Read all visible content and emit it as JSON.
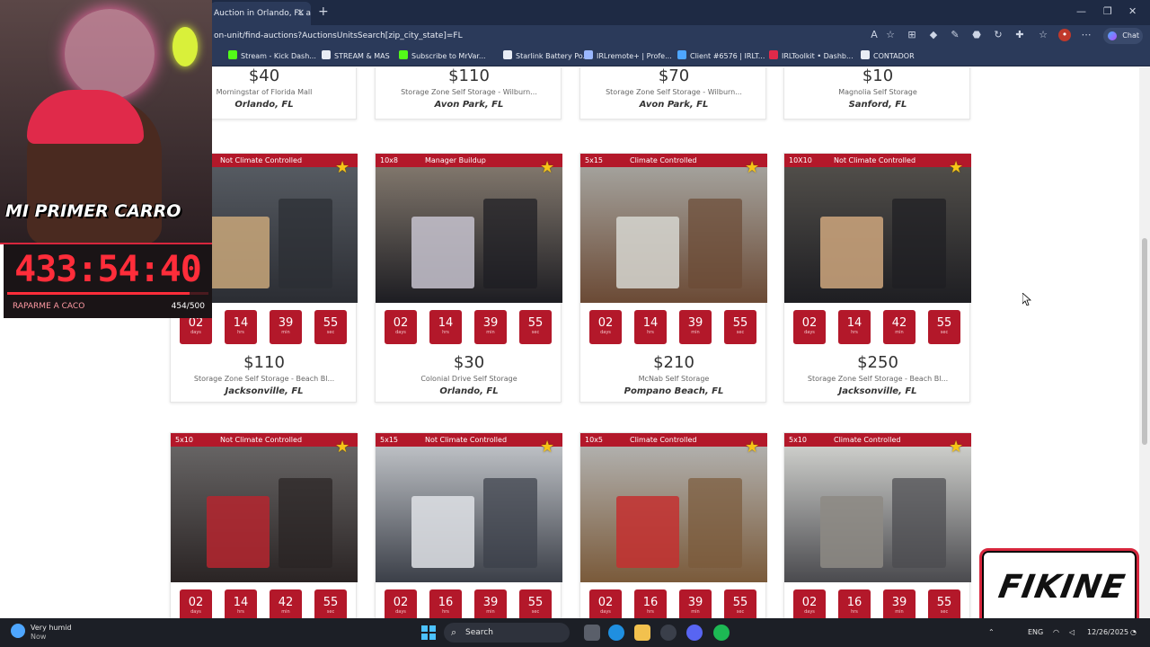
{
  "browser": {
    "tab_title": "Auction in Orlando, FL at",
    "tab_close": "×",
    "new_tab": "+",
    "window_min": "—",
    "window_max": "❐",
    "window_close": "✕",
    "url": "on-unit/find-auctions?AuctionsUnitsSearch[zip_city_state]=FL",
    "chat_label": "Chat",
    "bookmarks": [
      {
        "label": "Stream - Kick Dash...",
        "color": "#53fc18"
      },
      {
        "label": "STREAM & MAS",
        "color": "#e8ecf4"
      },
      {
        "label": "Subscribe to MrVar...",
        "color": "#53fc18"
      },
      {
        "label": "Starlink Battery Po...",
        "color": "#e8ecf4"
      },
      {
        "label": "IRLremote+ | Profe...",
        "color": "#9ab7ff"
      },
      {
        "label": "Client #6576 | IRLT...",
        "color": "#4ea6ff"
      },
      {
        "label": "IRLToolkit • Dashb...",
        "color": "#e02a4a"
      },
      {
        "label": "CONTADOR",
        "color": "#e8ecf4"
      }
    ]
  },
  "top_row": [
    {
      "price": "$40",
      "facility": "Morningstar of Florida Mall",
      "city": "Orlando, FL"
    },
    {
      "price": "$110",
      "facility": "Storage Zone Self Storage - Wilburn...",
      "city": "Avon Park, FL"
    },
    {
      "price": "$70",
      "facility": "Storage Zone Self Storage - Wilburn...",
      "city": "Avon Park, FL"
    },
    {
      "price": "$10",
      "facility": "Magnolia Self Storage",
      "city": "Sanford, FL"
    }
  ],
  "timer_units": [
    "days",
    "hrs",
    "min",
    "sec"
  ],
  "middle_row": [
    {
      "size": "",
      "condition": "Not Climate Controlled",
      "timer": [
        "02",
        "14",
        "39",
        "55"
      ],
      "price": "$110",
      "facility": "Storage Zone Self Storage - Beach Bl...",
      "city": "Jacksonville, FL",
      "colors": [
        "#5a5f66",
        "#2b2d33",
        "#c9a77a"
      ]
    },
    {
      "size": "10x8",
      "condition": "Manager Buildup",
      "timer": [
        "02",
        "14",
        "39",
        "55"
      ],
      "price": "$30",
      "facility": "Colonial Drive Self Storage",
      "city": "Orlando, FL",
      "colors": [
        "#8a7f73",
        "#1d1d22",
        "#c7c3cf"
      ]
    },
    {
      "size": "5x15",
      "condition": "Climate Controlled",
      "timer": [
        "02",
        "14",
        "39",
        "55"
      ],
      "price": "$210",
      "facility": "McNab Self Storage",
      "city": "Pompano Beach, FL",
      "colors": [
        "#a9aaa6",
        "#6b4a35",
        "#d6d6d0"
      ]
    },
    {
      "size": "10X10",
      "condition": "Not Climate Controlled",
      "timer": [
        "02",
        "14",
        "42",
        "55"
      ],
      "price": "$250",
      "facility": "Storage Zone Self Storage - Beach Bl...",
      "city": "Jacksonville, FL",
      "colors": [
        "#55524d",
        "#1e1e22",
        "#cfa77e"
      ]
    }
  ],
  "bottom_row": [
    {
      "size": "5x10",
      "condition": "Not Climate Controlled",
      "timer": [
        "02",
        "14",
        "42",
        "55"
      ],
      "colors": [
        "#6c6a6a",
        "#2a2424",
        "#b5262f"
      ]
    },
    {
      "size": "5x15",
      "condition": "Not Climate Controlled",
      "timer": [
        "02",
        "16",
        "39",
        "55"
      ],
      "colors": [
        "#c9ccd0",
        "#3b3f48",
        "#dfe2e6"
      ]
    },
    {
      "size": "10x5",
      "condition": "Climate Controlled",
      "timer": [
        "02",
        "16",
        "39",
        "55"
      ],
      "colors": [
        "#b6b8b8",
        "#7a5a3a",
        "#c43030"
      ]
    },
    {
      "size": "5x10",
      "condition": "Climate Controlled",
      "timer": [
        "02",
        "16",
        "39",
        "55"
      ],
      "colors": [
        "#d9dad6",
        "#4a4a4e",
        "#8d8a84"
      ]
    }
  ],
  "stream": {
    "banner_text": "MI PRIMER CARRO",
    "big_timer": "433:54:40",
    "goal_label": "RAPARME A CACO",
    "goal_count": "454/500",
    "goal_progress": 0.908,
    "brand_logo": "FIKINE"
  },
  "taskbar": {
    "weather_title": "Very humid",
    "weather_sub": "Now",
    "search_placeholder": "Search",
    "lang": "ENG",
    "date": "12/26/2025"
  }
}
